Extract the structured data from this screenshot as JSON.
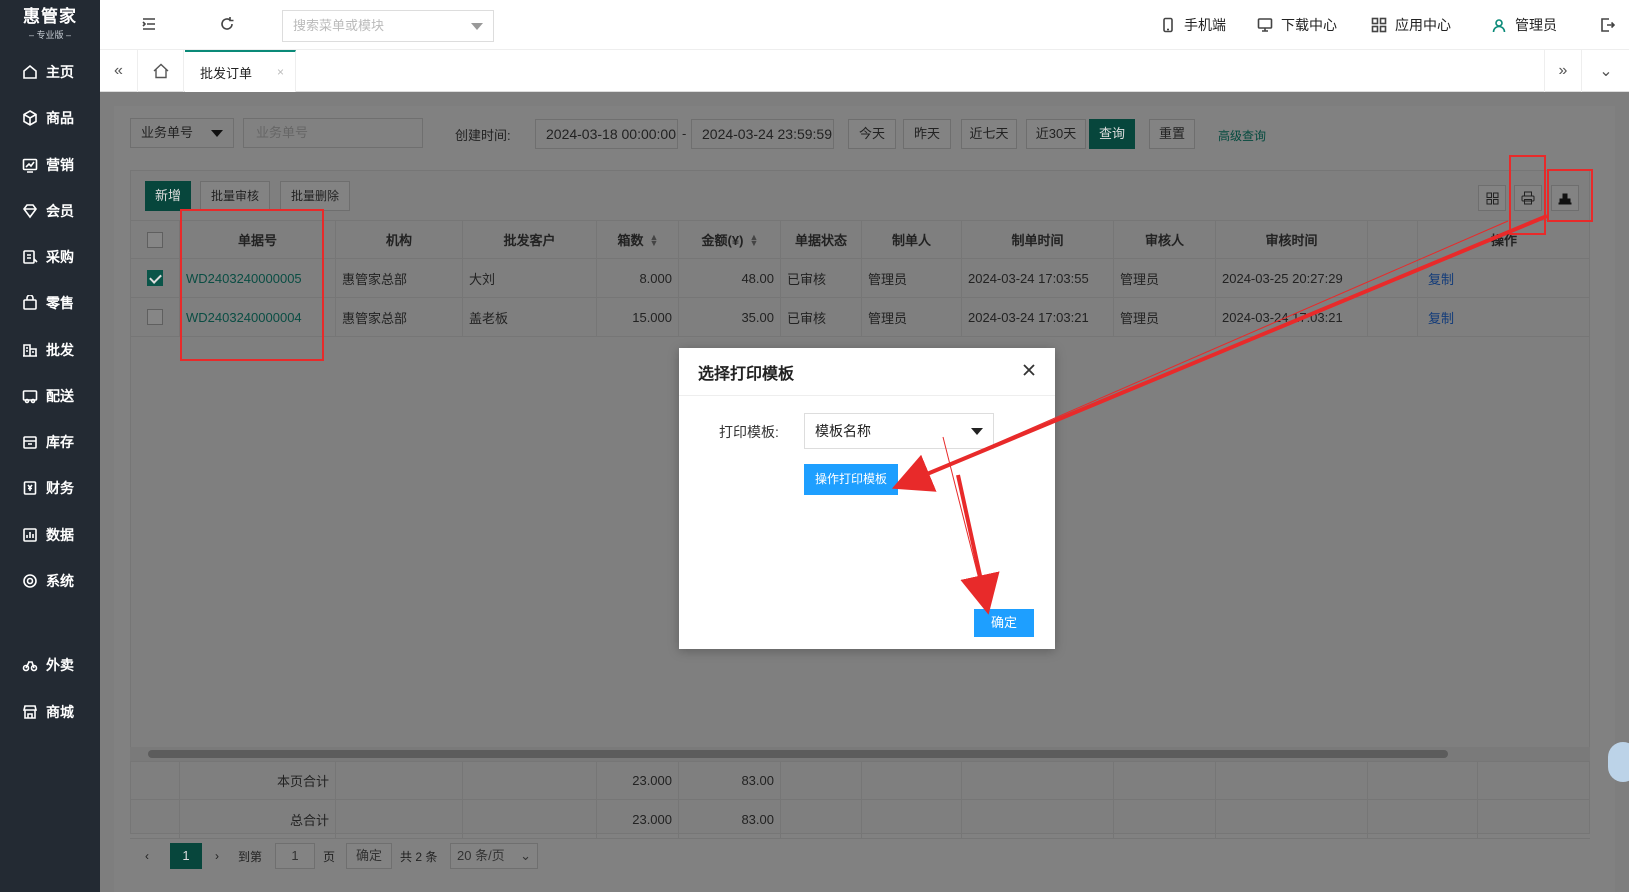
{
  "app": {
    "brand": "惠管家",
    "edition": "– 专业版 –"
  },
  "sidebar": {
    "items": [
      {
        "label": "主页",
        "icon": "home-icon"
      },
      {
        "label": "商品",
        "icon": "box-icon"
      },
      {
        "label": "营销",
        "icon": "chart-icon"
      },
      {
        "label": "会员",
        "icon": "diamond-icon"
      },
      {
        "label": "采购",
        "icon": "purchase-icon"
      },
      {
        "label": "零售",
        "icon": "bag-icon"
      },
      {
        "label": "批发",
        "icon": "building-icon"
      },
      {
        "label": "配送",
        "icon": "truck-icon"
      },
      {
        "label": "库存",
        "icon": "storage-icon"
      },
      {
        "label": "财务",
        "icon": "finance-icon"
      },
      {
        "label": "数据",
        "icon": "data-icon"
      },
      {
        "label": "系统",
        "icon": "settings-icon"
      },
      {
        "label": "外卖",
        "icon": "bike-icon"
      },
      {
        "label": "商城",
        "icon": "shop-icon"
      }
    ]
  },
  "topbar": {
    "search_placeholder": "搜索菜单或模块",
    "mobile": "手机端",
    "download": "下载中心",
    "apps": "应用中心",
    "user": "管理员"
  },
  "tabs": {
    "active": "批发订单",
    "close": "×",
    "prev": "«",
    "next": "»",
    "dropdown": "⌄"
  },
  "filters": {
    "field_select": "业务单号",
    "field_placeholder": "业务单号",
    "created_label": "创建时间:",
    "date_from": "2024-03-18 00:00:00",
    "date_sep": "-",
    "date_to": "2024-03-24 23:59:59",
    "today": "今天",
    "yesterday": "昨天",
    "last7": "近七天",
    "last30": "近30天",
    "query": "查询",
    "reset": "重置",
    "advanced": "高级查询"
  },
  "toolbar": {
    "add": "新增",
    "batch_audit": "批量审核",
    "batch_delete": "批量删除"
  },
  "table": {
    "headers": [
      "单据号",
      "机构",
      "批发客户",
      "箱数",
      "金额(¥)",
      "单据状态",
      "制单人",
      "制单时间",
      "审核人",
      "审核时间",
      "操作"
    ],
    "rows": [
      {
        "checked": true,
        "doc_no": "WD2403240000005",
        "org": "惠管家总部",
        "customer": "大刘",
        "boxes": "8.000",
        "amount": "48.00",
        "status": "已审核",
        "creator": "管理员",
        "created_at": "2024-03-24 17:03:55",
        "auditor": "管理员",
        "audited_at": "2024-03-25 20:27:29",
        "action": "复制"
      },
      {
        "checked": false,
        "doc_no": "WD2403240000004",
        "org": "惠管家总部",
        "customer": "盖老板",
        "boxes": "15.000",
        "amount": "35.00",
        "status": "已审核",
        "creator": "管理员",
        "created_at": "2024-03-24 17:03:21",
        "auditor": "管理员",
        "audited_at": "2024-03-24 17:03:21",
        "action": "复制"
      }
    ],
    "page_total_label": "本页合计",
    "page_total_boxes": "23.000",
    "page_total_amount": "83.00",
    "grand_total_label": "总合计",
    "grand_total_boxes": "23.000",
    "grand_total_amount": "83.00"
  },
  "pager": {
    "current": "1",
    "goto_label": "到第",
    "goto_value": "1",
    "page_unit": "页",
    "confirm": "确定",
    "total": "共 2 条",
    "page_size": "20 条/页"
  },
  "modal": {
    "title": "选择打印模板",
    "template_label": "打印模板:",
    "template_value": "模板名称",
    "op_button": "操作打印模板",
    "ok_button": "确定"
  },
  "colors": {
    "sidebar_bg": "#232a33",
    "brand_green": "#0a8a78",
    "primary_blue": "#1e9fff",
    "annotation_red": "#e82a2a"
  }
}
